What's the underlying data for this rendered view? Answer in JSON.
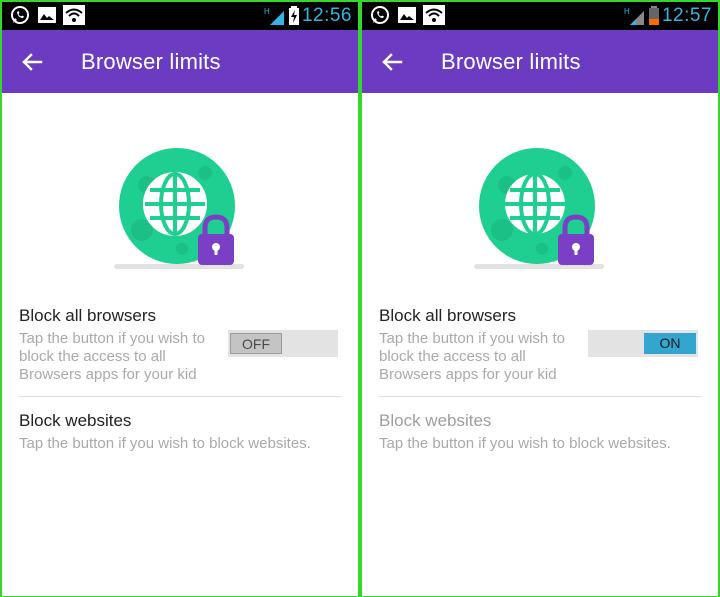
{
  "screens": [
    {
      "time": "12:56",
      "title": "Browser limits",
      "block_browsers": {
        "title": "Block all browsers",
        "description": "Tap the button if you wish to block the access to all Browsers apps for your kid",
        "toggle_label": "OFF",
        "toggle_state": "off"
      },
      "block_websites": {
        "title": "Block websites",
        "description": "Tap the button if you wish to block websites.",
        "enabled": true
      }
    },
    {
      "time": "12:57",
      "title": "Browser limits",
      "block_browsers": {
        "title": "Block all browsers",
        "description": "Tap the button if you wish to block the access to all Browsers apps for your kid",
        "toggle_label": "ON",
        "toggle_state": "on"
      },
      "block_websites": {
        "title": "Block websites",
        "description": "Tap the button if you wish to block websites.",
        "enabled": false
      }
    }
  ],
  "status_icons": [
    "whatsapp-icon",
    "gallery-icon",
    "wifi-icon",
    "signal-icon",
    "battery-icon"
  ],
  "colors": {
    "appbar": "#6b3cc2",
    "toggle_on": "#33a6cf",
    "globe": "#1fcf91",
    "lock": "#7a3fc4",
    "status_text": "#33b5e5",
    "frame": "#34d82a"
  }
}
